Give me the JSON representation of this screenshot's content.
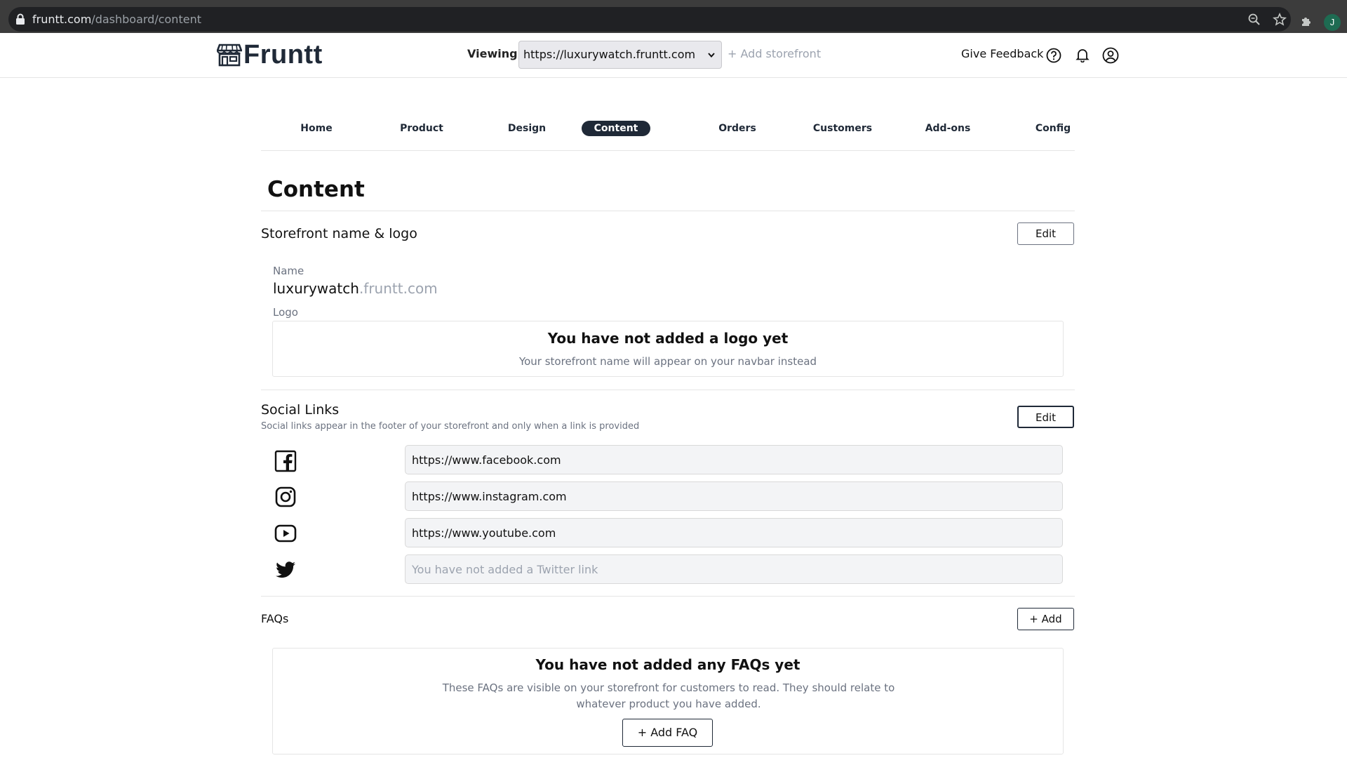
{
  "browser": {
    "url_domain": "fruntt.com",
    "url_path": "/dashboard/content",
    "profile_initial": "J"
  },
  "header": {
    "logo_text": "Fruntt",
    "viewing_label": "Viewing:",
    "storefront_selected": "https://luxurywatch.fruntt.com",
    "add_storefront": "+ Add storefront",
    "give_feedback": "Give Feedback"
  },
  "tabs": [
    {
      "label": "Home"
    },
    {
      "label": "Product"
    },
    {
      "label": "Design"
    },
    {
      "label": "Content",
      "active": true
    },
    {
      "label": "Orders"
    },
    {
      "label": "Customers"
    },
    {
      "label": "Add-ons"
    },
    {
      "label": "Config"
    }
  ],
  "page": {
    "title": "Content"
  },
  "storefront": {
    "title": "Storefront name & logo",
    "edit_label": "Edit",
    "name_label": "Name",
    "name_value": "luxurywatch",
    "name_domain": ".fruntt.com",
    "logo_label": "Logo",
    "logo_empty_title": "You have not added a logo yet",
    "logo_empty_sub": "Your storefront name will appear on your navbar instead"
  },
  "social": {
    "title": "Social Links",
    "subtitle": "Social links appear in the footer of your storefront and only when a link is provided",
    "edit_label": "Edit",
    "links": [
      {
        "icon": "facebook-icon",
        "value": "https://www.facebook.com",
        "placeholder": ""
      },
      {
        "icon": "instagram-icon",
        "value": "https://www.instagram.com",
        "placeholder": ""
      },
      {
        "icon": "youtube-icon",
        "value": "https://www.youtube.com",
        "placeholder": ""
      },
      {
        "icon": "twitter-icon",
        "value": "",
        "placeholder": "You have not added a Twitter link"
      }
    ]
  },
  "faqs": {
    "title": "FAQs",
    "add_label": "+ Add",
    "empty_title": "You have not added any FAQs yet",
    "empty_sub": "These FAQs are visible on your storefront for customers to read. They should relate to whatever product you have added.",
    "add_faq_label": "+ Add FAQ"
  },
  "colors": {
    "primary_dark": "#1f2937",
    "muted_text": "#6b7280",
    "chrome_bg": "#3c3c3c"
  }
}
